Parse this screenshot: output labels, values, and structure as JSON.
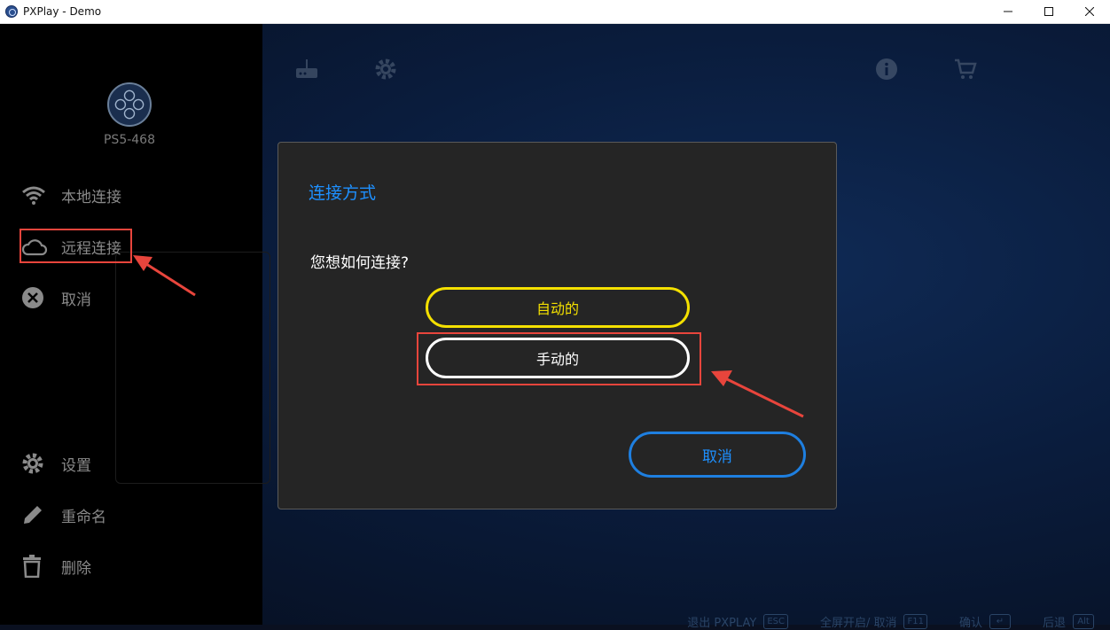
{
  "window": {
    "title": "PXPlay - Demo"
  },
  "sidebar": {
    "device_name": "PS5-468",
    "items": [
      {
        "label": "本地连接",
        "icon": "wifi-icon"
      },
      {
        "label": "远程连接",
        "icon": "cloud-icon"
      },
      {
        "label": "取消",
        "icon": "cancel-circle-icon"
      },
      {
        "label": "设置",
        "icon": "gear-icon"
      },
      {
        "label": "重命名",
        "icon": "pencil-icon"
      },
      {
        "label": "删除",
        "icon": "trash-icon"
      }
    ]
  },
  "dialog": {
    "title": "连接方式",
    "question": "您想如何连接?",
    "auto_label": "自动的",
    "manual_label": "手动的",
    "cancel_label": "取消"
  },
  "footer": {
    "exit_label": "退出 PXPLAY",
    "exit_key": "ESC",
    "fullscreen_label": "全屏开启/ 取消",
    "fullscreen_key": "F11",
    "confirm_label": "确认",
    "back_label": "后退",
    "back_key": "Alt"
  },
  "colors": {
    "accent_blue": "#1e90ff",
    "accent_yellow": "#f4e000",
    "highlight_red": "#e8453c"
  }
}
